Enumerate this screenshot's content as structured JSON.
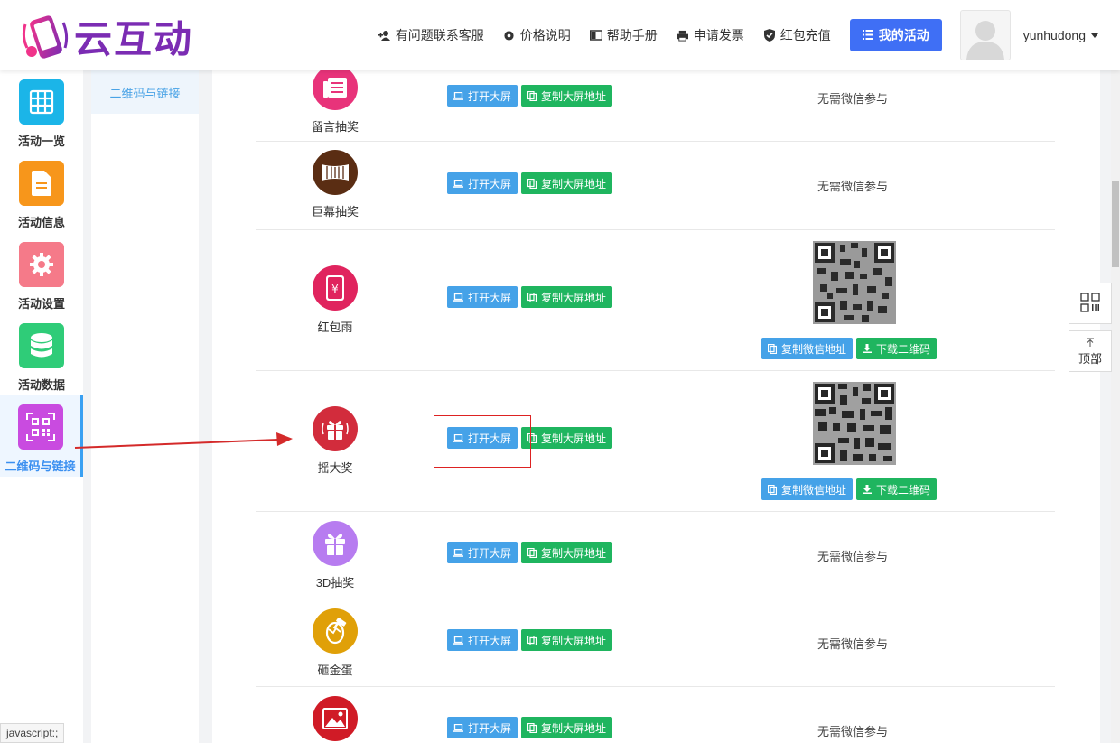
{
  "brand": {
    "name": "云互动"
  },
  "nav": {
    "items": [
      {
        "label": "有问题联系客服",
        "icon": "user-plus-icon"
      },
      {
        "label": "价格说明",
        "icon": "gear-icon"
      },
      {
        "label": "帮助手册",
        "icon": "book-icon"
      },
      {
        "label": "申请发票",
        "icon": "printer-icon"
      },
      {
        "label": "红包充值",
        "icon": "shield-check-icon"
      }
    ],
    "my_activity": "我的活动",
    "username": "yunhudong"
  },
  "sidebar": {
    "items": [
      {
        "label": "活动一览",
        "color": "#1bb5e8",
        "icon": "grid-icon"
      },
      {
        "label": "活动信息",
        "color": "#f7961b",
        "icon": "document-icon"
      },
      {
        "label": "活动设置",
        "color": "#f57a89",
        "icon": "gear-icon"
      },
      {
        "label": "活动数据",
        "color": "#2fcc78",
        "icon": "database-icon"
      },
      {
        "label": "二维码与链接",
        "color": "#c94be0",
        "icon": "qrcode-icon",
        "active": true
      }
    ]
  },
  "subsidebar": {
    "active_item": "二维码与链接"
  },
  "buttons": {
    "open_screen": "打开大屏",
    "copy_screen_url": "复制大屏地址",
    "copy_wechat_url": "复制微信地址",
    "download_qr": "下载二维码"
  },
  "no_wechat_text": "无需微信参与",
  "games": [
    {
      "name": "留言抽奖",
      "color": "#e8337a",
      "icon": "message-icon",
      "needs_wechat": false
    },
    {
      "name": "巨幕抽奖",
      "color": "#5a2d13",
      "icon": "screen-icon",
      "needs_wechat": false
    },
    {
      "name": "红包雨",
      "color": "#e0245e",
      "icon": "red-envelope-icon",
      "needs_wechat": true
    },
    {
      "name": "摇大奖",
      "color": "#d22c3c",
      "icon": "gift-shake-icon",
      "needs_wechat": true
    },
    {
      "name": "3D抽奖",
      "color": "#b77cf0",
      "icon": "gift-box-icon",
      "needs_wechat": false
    },
    {
      "name": "砸金蛋",
      "color": "#e0a008",
      "icon": "golden-egg-icon",
      "needs_wechat": false
    },
    {
      "name": "",
      "color": "#d01b26",
      "icon": "image-icon",
      "needs_wechat": false
    }
  ],
  "float": {
    "top_label": "顶部"
  },
  "status_bar": "javascript:;"
}
